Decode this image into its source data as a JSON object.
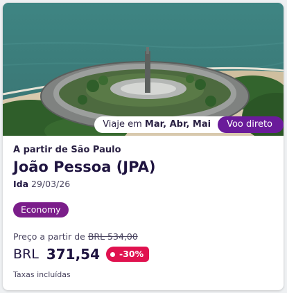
{
  "image": {
    "description_icon": "hotel-ring-building-photo",
    "colors": {
      "sea": "#3c7d7c",
      "sand": "#d9cbb0",
      "foliage": "#2f5e2a",
      "roof": "#8e918f"
    }
  },
  "pills": {
    "dates_prefix": "Viaje em",
    "dates_months": "Mar, Abr, Mai",
    "direct_label": "Voo direto"
  },
  "offer": {
    "origin": "A partir de São Paulo",
    "destination": "João Pessoa (JPA)",
    "trip_type": "Ida",
    "date": "29/03/26",
    "cabin": "Economy",
    "price_from_label": "Preço a partir de",
    "old_price": "BRL 534,00",
    "currency": "BRL",
    "price": "371,54",
    "discount": "-30%",
    "taxes_note": "Taxas incluídas"
  },
  "colors": {
    "accent": "#6a1b9a",
    "badge": "#7b1e8a",
    "discount": "#e0124f",
    "text": "#1f1440"
  }
}
